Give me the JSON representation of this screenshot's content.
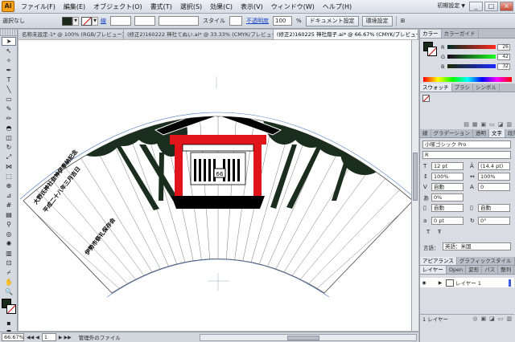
{
  "app": {
    "logo": "Ai"
  },
  "menubar": {
    "items": [
      "ファイル(F)",
      "編集(E)",
      "オブジェクト(O)",
      "書式(T)",
      "選択(S)",
      "効果(C)",
      "表示(V)",
      "ウィンドウ(W)",
      "ヘルプ(H)"
    ],
    "workspace": "初期設定",
    "window_controls": [
      "_",
      "□",
      "×"
    ]
  },
  "controlbar": {
    "selection_label": "選択なし",
    "stroke_label": "線",
    "style_label": "スタイル",
    "opacity_label": "不透明度",
    "opacity_value": "100",
    "opacity_unit": "%",
    "doc_setup_button": "ドキュメント設定",
    "prefs_button": "環境設定",
    "fill_color": "#1a2a1a"
  },
  "doctabs": [
    {
      "label": "名称未設定-1* @ 100% (RGB/プレビュー)",
      "close": "×",
      "active": false
    },
    {
      "label": "(修正2)160222 神社てぬい.ai* @ 33.33% (CMYK/プレビュー)",
      "close": "×",
      "active": false
    },
    {
      "label": "(修正2)160225 神社扇子.ai* @ 66.67% (CMYK/プレビュー)",
      "close": "×",
      "active": true
    }
  ],
  "artwork": {
    "line1": "大野氏神社会神伊奉納記念",
    "line2": "平成二十八年三月吉日",
    "line3": "伊勢市祭礼保存会",
    "lantern_text": "66",
    "colors": {
      "tree": "#1b2e1e",
      "shrine_red": "#e0141a",
      "black": "#000000"
    }
  },
  "statusbar": {
    "zoom": "66.67%",
    "page": "1",
    "nav_first": "◀◀",
    "nav_prev": "◀",
    "nav_next": "▶",
    "nav_last": "▶▶",
    "message": "管理外のファイル"
  },
  "panels": {
    "color": {
      "tabs": [
        "カラー",
        "カラーガイド"
      ],
      "r_label": "R",
      "r_value": "26",
      "g_label": "G",
      "g_value": "42",
      "b_label": "B",
      "b_value": "32"
    },
    "swatches": {
      "tabs": [
        "スウォッチ",
        "ブラシ",
        "シンボル"
      ]
    },
    "character": {
      "tabs": [
        "線",
        "グラデーション",
        "透明",
        "文字",
        "段落"
      ],
      "font_family": "小塚ゴシック Pro",
      "font_style": "R",
      "font_size": "12 pt",
      "leading": "(14.4 pt)",
      "v_scale": "100%",
      "h_scale": "100%",
      "kerning": "自動",
      "tracking": "0",
      "tsume": "0%",
      "aki_left": "自動",
      "aki_right": "自動",
      "baseline": "0 pt",
      "rotation": "0°",
      "language_label": "言語：",
      "language": "英語：米国"
    },
    "appearance": {
      "tabs": [
        "アピアランス",
        "グラフィックスタイル"
      ]
    },
    "layers": {
      "tabs": [
        "レイヤー",
        "Open",
        "変形",
        "パス",
        "整列"
      ],
      "layer_name": "レイヤー 1",
      "count": "1 レイヤー"
    }
  }
}
